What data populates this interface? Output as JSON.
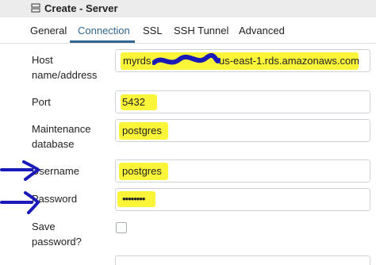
{
  "window": {
    "title": "Create - Server",
    "icon": "server-icon"
  },
  "tabs": [
    {
      "label": "General",
      "active": false
    },
    {
      "label": "Connection",
      "active": true
    },
    {
      "label": "SSL",
      "active": false
    },
    {
      "label": "SSH Tunnel",
      "active": false
    },
    {
      "label": "Advanced",
      "active": false
    }
  ],
  "form": {
    "host": {
      "label_line1": "Host",
      "label_line2": "name/address",
      "value_start": "myrds",
      "value_end": "us-east-1.rds.amazonaws.com"
    },
    "port": {
      "label": "Port",
      "value": "5432"
    },
    "maintenance_db": {
      "label_line1": "Maintenance",
      "label_line2": "database",
      "value": "postgres"
    },
    "username": {
      "label": "Username",
      "value": "postgres"
    },
    "password": {
      "label": "Password",
      "value": "••••••••"
    },
    "save_password": {
      "label_line1": "Save",
      "label_line2": "password?",
      "checked": false
    }
  },
  "colors": {
    "accent": "#326690",
    "highlight": "#fbf53a",
    "annotation": "#1a1ab8"
  }
}
